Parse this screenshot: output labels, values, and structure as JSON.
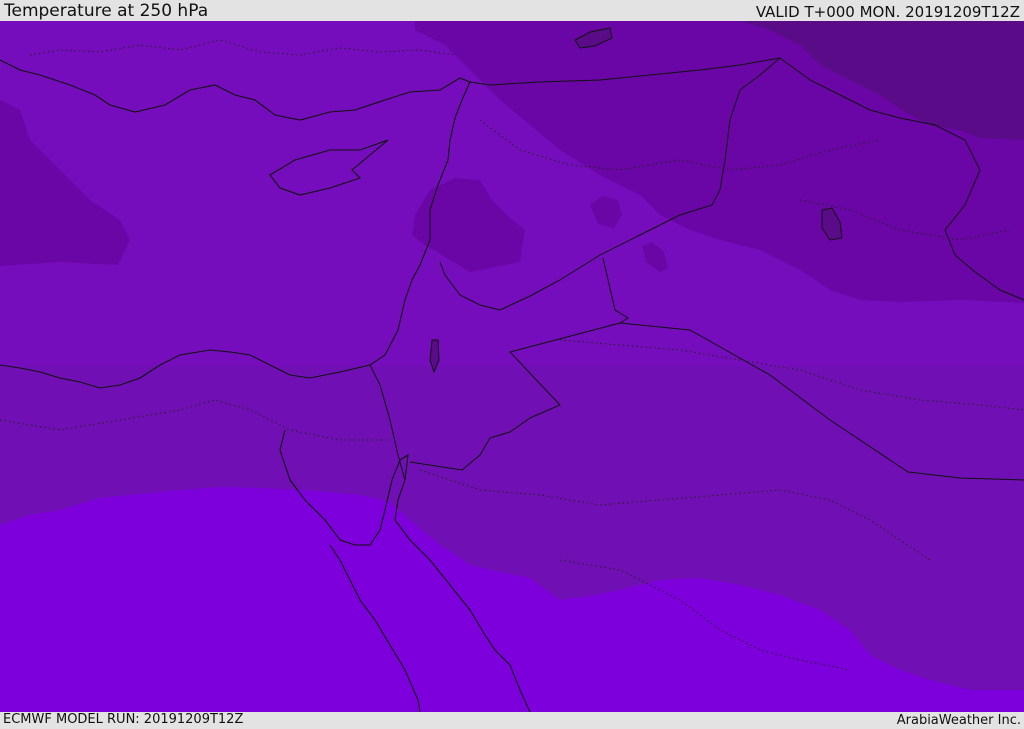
{
  "header": {
    "title": "Temperature at 250 hPa",
    "valid": "VALID T+000 MON. 20191209T12Z"
  },
  "footer": {
    "model_run": "ECMWF MODEL RUN: 20191209T12Z",
    "credit": "ArabiaWeather Inc."
  },
  "map": {
    "variable": "temperature",
    "level": "250 hPa",
    "palette": {
      "coldest": "#5a0b88",
      "colder": "#6a06a6",
      "cold": "#760dbd",
      "mid": "#7010b4",
      "warm": "#7d00dc"
    }
  }
}
